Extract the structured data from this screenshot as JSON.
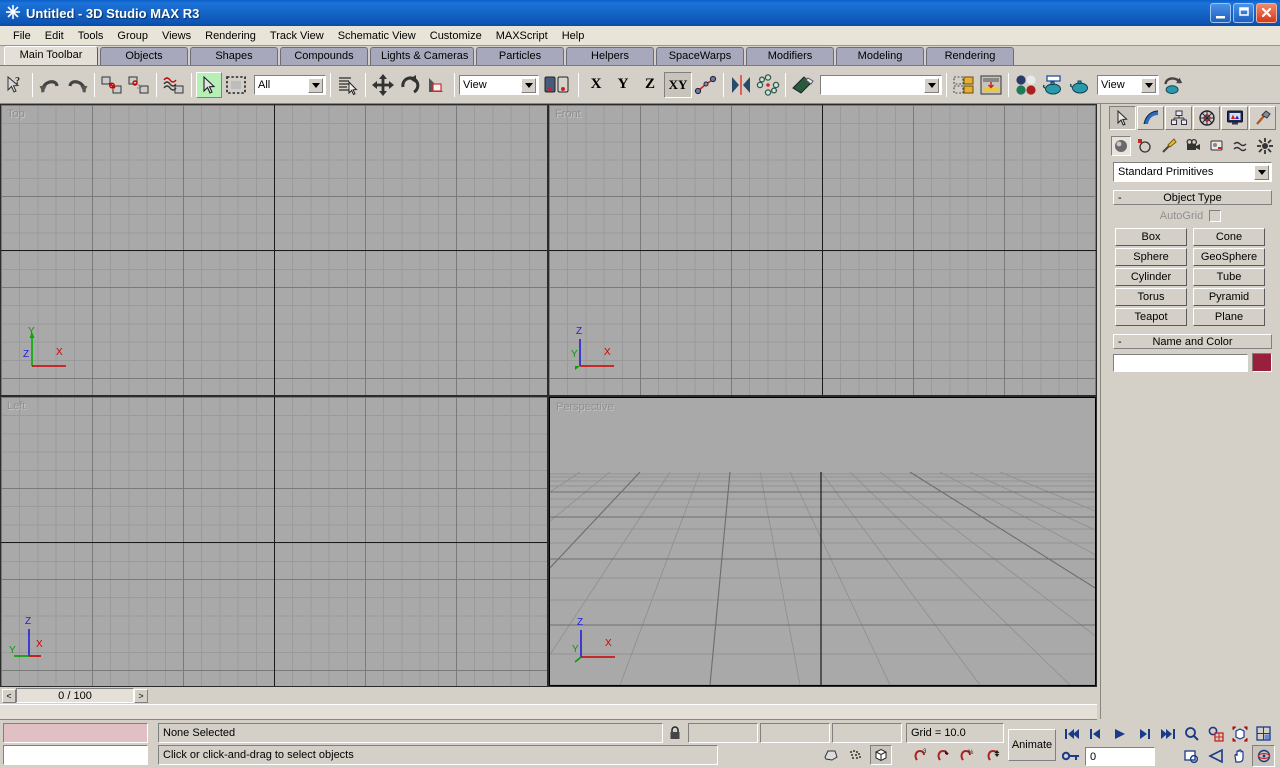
{
  "window": {
    "title": "Untitled - 3D Studio MAX R3",
    "app_icon": "max-starburst-icon",
    "minimize_label": "_",
    "restore_label": "❐",
    "close_label": "✕"
  },
  "menu": {
    "items": [
      {
        "label": "File"
      },
      {
        "label": "Edit"
      },
      {
        "label": "Tools"
      },
      {
        "label": "Group"
      },
      {
        "label": "Views"
      },
      {
        "label": "Rendering"
      },
      {
        "label": "Track View"
      },
      {
        "label": "Schematic View"
      },
      {
        "label": "Customize"
      },
      {
        "label": "MAXScript"
      },
      {
        "label": "Help"
      }
    ]
  },
  "tabpanel": {
    "tabs": [
      {
        "label": "Main Toolbar",
        "active": true
      },
      {
        "label": "Objects",
        "active": false
      },
      {
        "label": "Shapes",
        "active": false
      },
      {
        "label": "Compounds",
        "active": false
      },
      {
        "label": "Lights & Cameras",
        "active": false
      },
      {
        "label": "Particles",
        "active": false
      },
      {
        "label": "Helpers",
        "active": false
      },
      {
        "label": "SpaceWarps",
        "active": false
      },
      {
        "label": "Modifiers",
        "active": false
      },
      {
        "label": "Modeling",
        "active": false
      },
      {
        "label": "Rendering",
        "active": false
      }
    ]
  },
  "toolbar": {
    "selection_filter_value": "All",
    "reference_coord_value": "View",
    "named_selection_value": "",
    "viewport_list_value": "View",
    "axis_x_label": "X",
    "axis_y_label": "Y",
    "axis_z_label": "Z",
    "axis_xy_label": "XY",
    "buttons": [
      {
        "name": "undo-view-change-icon",
        "tip": "Undo"
      },
      {
        "name": "redo-view-change-icon",
        "tip": "Redo"
      },
      {
        "name": "select-and-link-icon",
        "tip": "Select and Link"
      },
      {
        "name": "unlink-selection-icon",
        "tip": "Unlink Selection"
      },
      {
        "name": "bind-to-space-warp-icon",
        "tip": "Bind to Space Warp"
      },
      {
        "name": "select-object-icon",
        "tip": "Select Object"
      },
      {
        "name": "select-region-icon",
        "tip": "Rectangular Selection Region"
      },
      {
        "name": "select-by-name-icon",
        "tip": "Select by Name"
      },
      {
        "name": "select-and-move-icon",
        "tip": "Select and Move"
      },
      {
        "name": "select-and-rotate-icon",
        "tip": "Select and Rotate"
      },
      {
        "name": "select-and-scale-icon",
        "tip": "Select and Uniform Scale"
      },
      {
        "name": "use-pivot-center-icon",
        "tip": "Use Pivot Point Center"
      },
      {
        "name": "mirror-icon",
        "tip": "Mirror Selected Objects"
      },
      {
        "name": "align-icon",
        "tip": "Align"
      },
      {
        "name": "material-editor-icon",
        "tip": "Material Editor"
      },
      {
        "name": "render-scene-icon",
        "tip": "Render Scene"
      },
      {
        "name": "quick-render-icon",
        "tip": "Quick Render"
      },
      {
        "name": "render-type-icon",
        "tip": "Render Type"
      }
    ]
  },
  "viewports": [
    {
      "name": "top",
      "label": "Top",
      "active": false,
      "tripod": {
        "up_label": "Y",
        "origin_label": "Z",
        "right_label": "X"
      }
    },
    {
      "name": "front",
      "label": "Front",
      "active": false,
      "tripod": {
        "up_label": "Z",
        "origin_label": "Y",
        "right_label": "X"
      }
    },
    {
      "name": "left",
      "label": "Left",
      "active": false,
      "tripod": {
        "up_label": "Z",
        "origin_label": "Y",
        "right_label": "X"
      }
    },
    {
      "name": "perspective",
      "label": "Perspective",
      "active": true,
      "tripod": {
        "up_label": "Z",
        "origin_label": "Y",
        "right_label": "X"
      }
    }
  ],
  "command_panel": {
    "tabs": [
      {
        "name": "create-tab",
        "icon": "arrow-cursor-icon",
        "active": true
      },
      {
        "name": "modify-tab",
        "icon": "curve-modify-icon",
        "active": false
      },
      {
        "name": "hierarchy-tab",
        "icon": "hierarchy-tree-icon",
        "active": false
      },
      {
        "name": "motion-tab",
        "icon": "motion-wheel-icon",
        "active": false
      },
      {
        "name": "display-tab",
        "icon": "display-monitor-icon",
        "active": false
      },
      {
        "name": "utilities-tab",
        "icon": "hammer-icon",
        "active": false
      }
    ],
    "categories": [
      {
        "name": "geometry-category",
        "icon": "sphere-icon",
        "active": true
      },
      {
        "name": "shapes-category",
        "icon": "shapes-icon",
        "active": false
      },
      {
        "name": "lights-category",
        "icon": "light-icon",
        "active": false
      },
      {
        "name": "cameras-category",
        "icon": "camera-icon",
        "active": false
      },
      {
        "name": "helpers-category",
        "icon": "helper-icon",
        "active": false
      },
      {
        "name": "spacewarps-category",
        "icon": "wave-icon",
        "active": false
      },
      {
        "name": "systems-category",
        "icon": "systems-icon",
        "active": false
      }
    ],
    "subcategory_value": "Standard Primitives",
    "object_type": {
      "rollout_label": "Object Type",
      "collapse_glyph": "-",
      "autogrid_label": "AutoGrid",
      "autogrid_checked": false,
      "buttons": [
        {
          "label": "Box"
        },
        {
          "label": "Cone"
        },
        {
          "label": "Sphere"
        },
        {
          "label": "GeoSphere"
        },
        {
          "label": "Cylinder"
        },
        {
          "label": "Tube"
        },
        {
          "label": "Torus"
        },
        {
          "label": "Pyramid"
        },
        {
          "label": "Teapot"
        },
        {
          "label": "Plane"
        }
      ]
    },
    "name_and_color": {
      "rollout_label": "Name and Color",
      "collapse_glyph": "-",
      "name_value": "",
      "color": "#99203c"
    }
  },
  "timeslider": {
    "prev_label": "<",
    "next_label": ">",
    "frame_label": "0 / 100"
  },
  "statusbar": {
    "transform_type_in_value": "",
    "prompt_field_value": "",
    "selection_status": "None Selected",
    "prompt_text": "Click or click-and-drag to select objects",
    "lock_icon": "lock-selection-icon",
    "coord_x_value": "",
    "coord_y_value": "",
    "coord_z_value": "",
    "grid_text": "Grid = 10.0",
    "animate_label": "Animate",
    "time_field_value": "0",
    "key_mode_icon": "key-mode-icon",
    "playback": [
      {
        "name": "goto-start-button",
        "glyph": "start"
      },
      {
        "name": "previous-frame-button",
        "glyph": "prev"
      },
      {
        "name": "play-animation-button",
        "glyph": "play"
      },
      {
        "name": "next-frame-button",
        "glyph": "next"
      },
      {
        "name": "goto-end-button",
        "glyph": "end"
      }
    ],
    "nav_top": [
      {
        "name": "zoom-button",
        "icon": "magnifier-icon"
      },
      {
        "name": "zoom-all-button",
        "icon": "zoom-all-icon"
      },
      {
        "name": "zoom-extents-button",
        "icon": "zoom-extents-icon"
      },
      {
        "name": "zoom-extents-all-button",
        "icon": "zoom-extents-all-icon"
      }
    ],
    "nav_bottom": [
      {
        "name": "region-zoom-button",
        "icon": "region-zoom-icon"
      },
      {
        "name": "field-of-view-button",
        "icon": "fov-icon"
      },
      {
        "name": "pan-button",
        "icon": "hand-icon"
      },
      {
        "name": "arc-rotate-button",
        "icon": "arc-rotate-icon"
      },
      {
        "name": "min-max-toggle-button",
        "icon": "min-max-toggle-icon"
      }
    ],
    "snap_buttons": [
      {
        "name": "snap-toggle-button",
        "icon": "snap-icon"
      },
      {
        "name": "angle-snap-button",
        "icon": "angle-snap-icon"
      },
      {
        "name": "percent-snap-button",
        "icon": "percent-snap-icon"
      },
      {
        "name": "spinner-snap-button",
        "icon": "spinner-snap-icon"
      }
    ],
    "shade_buttons": [
      {
        "name": "degradation-override-button",
        "icon": "degradation-icon"
      },
      {
        "name": "adaptive-degradation-button",
        "icon": "adaptive-icon"
      },
      {
        "name": "selected-objects-button",
        "icon": "cube-icon"
      }
    ]
  }
}
